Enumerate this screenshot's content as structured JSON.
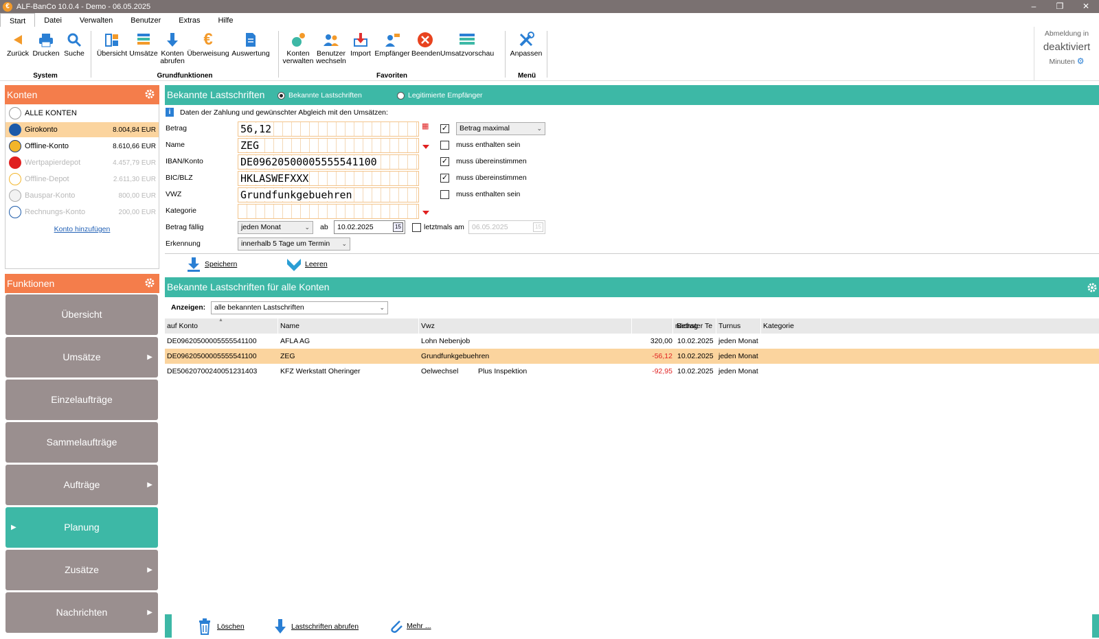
{
  "window": {
    "title": "ALF-BanCo 10.0.4 - Demo - 06.05.2025",
    "minimize": "–",
    "restore": "❐",
    "close": "✕"
  },
  "menu": [
    "Start",
    "Datei",
    "Verwalten",
    "Benutzer",
    "Extras",
    "Hilfe"
  ],
  "ribbon": {
    "groups": {
      "system": "System",
      "grund": "Grundfunktionen",
      "fav": "Favoriten",
      "menu": "Menü"
    },
    "buttons": {
      "zurueck": "Zurück",
      "drucken": "Drucken",
      "suche": "Suche",
      "uebersicht": "Übersicht",
      "umsaetze": "Umsätze",
      "konten_abrufen_1": "Konten",
      "konten_abrufen_2": "abrufen",
      "ueberweisung": "Überweisung",
      "auswertung": "Auswertung",
      "konten_verwalten_1": "Konten",
      "konten_verwalten_2": "verwalten",
      "benutzer_wechseln_1": "Benutzer",
      "benutzer_wechseln_2": "wechseln",
      "import": "Import",
      "empfaenger": "Empfänger",
      "beenden": "Beenden",
      "umsatzvorschau": "Umsatzvorschau",
      "anpassen": "Anpassen"
    },
    "logout": {
      "line1": "Abmeldung in",
      "line2": "deaktiviert",
      "line3": "Minuten"
    }
  },
  "konten": {
    "title": "Konten",
    "alle": "ALLE KONTEN",
    "items": [
      {
        "name": "Girokonto",
        "amount": "8.004,84 EUR"
      },
      {
        "name": "Offline-Konto",
        "amount": "8.610,66 EUR"
      },
      {
        "name": "Wertpapierdepot",
        "amount": "4.457,79 EUR"
      },
      {
        "name": "Offline-Depot",
        "amount": "2.611,30 EUR"
      },
      {
        "name": "Bauspar-Konto",
        "amount": "800,00 EUR"
      },
      {
        "name": "Rechnungs-Konto",
        "amount": "200,00 EUR"
      }
    ],
    "add": "Konto hinzufügen"
  },
  "funktionen": {
    "title": "Funktionen",
    "items": [
      "Übersicht",
      "Umsätze",
      "Einzelaufträge",
      "Sammelaufträge",
      "Aufträge",
      "Planung",
      "Zusätze",
      "Nachrichten"
    ]
  },
  "form": {
    "title": "Bekannte Lastschriften",
    "radio1": "Bekannte Lastschriften",
    "radio2": "Legitimierte Empfänger",
    "info": "Daten der Zahlung und gewünschter Abgleich mit den Umsätzen:",
    "labels": {
      "betrag": "Betrag",
      "name": "Name",
      "iban": "IBAN/Konto",
      "bic": "BIC/BLZ",
      "vwz": "VWZ",
      "kategorie": "Kategorie",
      "faellig": "Betrag fällig",
      "erkennung": "Erkennung"
    },
    "values": {
      "betrag": "56,12",
      "name": "ZEG",
      "iban": "DE09620500005555541100",
      "bic": "HKLASWEFXXX",
      "vwz": "Grundfunkgebuehren",
      "kategorie": ""
    },
    "checks": {
      "betrag_sel": "Betrag maximal",
      "name": "muss enthalten sein",
      "iban": "muss übereinstimmen",
      "bic": "muss übereinstimmen",
      "vwz": "muss enthalten sein"
    },
    "faellig_sel": "jeden Monat",
    "ab": "ab",
    "ab_date": "10.02.2025",
    "letztmals": "letztmals am",
    "letztmals_date": "06.05.2025",
    "erkennung_sel": "innerhalb 5 Tage um Termin",
    "speichern": "Speichern",
    "leeren": "Leeren"
  },
  "list": {
    "title": "Bekannte Lastschriften für alle Konten",
    "anzeigen_label": "Anzeigen:",
    "anzeigen_sel": "alle bekannten Lastschriften",
    "columns": [
      "auf Konto",
      "Name",
      "Vwz",
      "Betrag",
      "nächster Te",
      "Turnus",
      "Kategorie"
    ],
    "rows": [
      {
        "konto": "DE09620500005555541100",
        "name": "AFLA AG",
        "vwz": "Lohn Nebenjob",
        "vwz2": "",
        "betrag": "320,00",
        "next": "10.02.2025",
        "turnus": "jeden Monat",
        "kat": ""
      },
      {
        "konto": "DE09620500005555541100",
        "name": "ZEG",
        "vwz": "Grundfunkgebuehren",
        "vwz2": "",
        "betrag": "-56,12",
        "next": "10.02.2025",
        "turnus": "jeden Monat",
        "kat": ""
      },
      {
        "konto": "DE50620700240051231403",
        "name": "KFZ Werkstatt Oheringer",
        "vwz": "Oelwechsel",
        "vwz2": "Plus Inspektion",
        "betrag": "-92,95",
        "next": "10.02.2025",
        "turnus": "jeden Monat",
        "kat": ""
      }
    ]
  },
  "bottom": {
    "loeschen": "Löschen",
    "abrufen": "Lastschriften abrufen",
    "mehr": "Mehr ..."
  },
  "colors": {
    "accent": "#3db8a6",
    "orange": "#f47d4b",
    "selection": "#fbd49e",
    "negative": "#e02020"
  }
}
